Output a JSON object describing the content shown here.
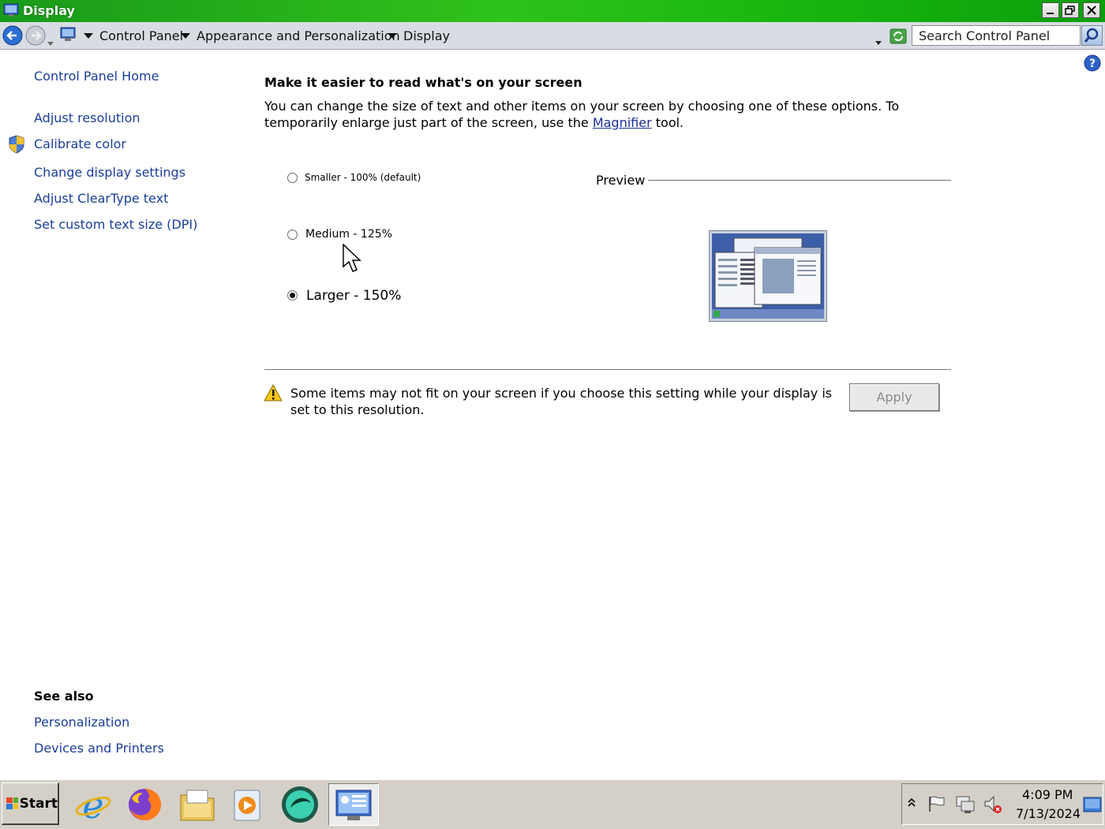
{
  "window": {
    "title": "Display"
  },
  "address": {
    "crumbs": [
      "Control Panel",
      "Appearance and Personalization",
      "Display"
    ],
    "search_placeholder": "Search Control Panel"
  },
  "sidebar": {
    "home": "Control Panel Home",
    "links": [
      "Adjust resolution",
      "Calibrate color",
      "Change display settings",
      "Adjust ClearType text",
      "Set custom text size (DPI)"
    ],
    "see_also_title": "See also",
    "see_also": [
      "Personalization",
      "Devices and Printers"
    ]
  },
  "main": {
    "heading": "Make it easier to read what's on your screen",
    "desc_before": "You can change the size of text and other items on your screen by choosing one of these options. To temporarily enlarge just part of the screen, use the ",
    "desc_link": "Magnifier",
    "desc_after": " tool.",
    "options": [
      {
        "label": "Smaller - 100% (default)",
        "selected": false
      },
      {
        "label": "Medium - 125%",
        "selected": false
      },
      {
        "label": "Larger - 150%",
        "selected": true
      }
    ],
    "preview_label": "Preview",
    "warning": "Some items may not fit on your screen if you choose this setting while your display is set to this resolution.",
    "apply_label": "Apply"
  },
  "taskbar": {
    "start_label": "Start",
    "time": "4:09 PM",
    "date": "7/13/2024"
  }
}
